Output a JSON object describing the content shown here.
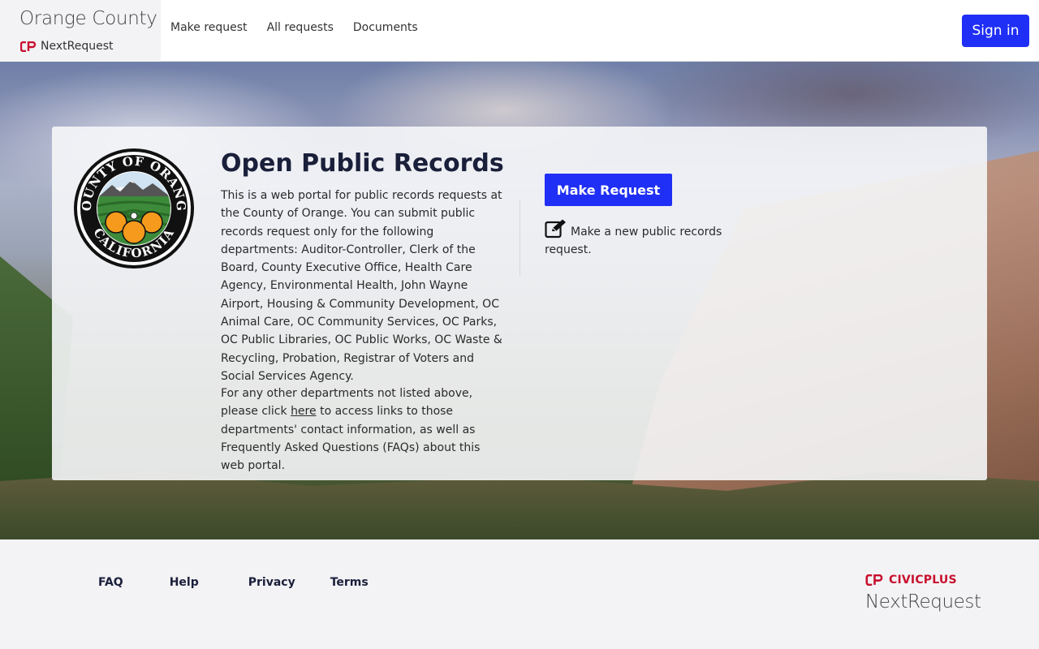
{
  "header": {
    "brand_title": "Orange County",
    "brand_sub": "NextRequest",
    "nav": [
      {
        "label": "Make request"
      },
      {
        "label": "All requests"
      },
      {
        "label": "Documents"
      }
    ],
    "signin_label": "Sign in"
  },
  "card": {
    "seal_text_top": "COUNTY OF ORANGE",
    "seal_text_bottom": "CALIFORNIA",
    "title": "Open Public Records",
    "description": "This is a web portal for public records requests at the County of Orange. You can submit public records request only for the following departments: Auditor-Controller, Clerk of the Board, County Executive Office, Health Care Agency, Environmental Health, John Wayne Airport, Housing & Community Development, OC Animal Care, OC Community Services, OC Parks, OC Public Libraries, OC Public Works, OC Waste & Recycling, Probation, Registrar of Voters and Social Services Agency.",
    "other_pre": "For any other departments not listed above, please click ",
    "other_link": "here",
    "other_post": " to access links to those departments' contact information, as well as Frequently Asked Questions (FAQs) about this web portal.",
    "make_request_label": "Make Request",
    "make_request_note": "Make a new public records request."
  },
  "footer": {
    "links": [
      {
        "label": "FAQ"
      },
      {
        "label": "Help"
      },
      {
        "label": "Privacy"
      },
      {
        "label": "Terms"
      }
    ],
    "civic_label": "CIVICPLUS",
    "nextrequest_label": "NextRequest"
  },
  "colors": {
    "primary": "#1f2ff5",
    "brand_red": "#c8102e",
    "heading": "#1a1f3a"
  }
}
